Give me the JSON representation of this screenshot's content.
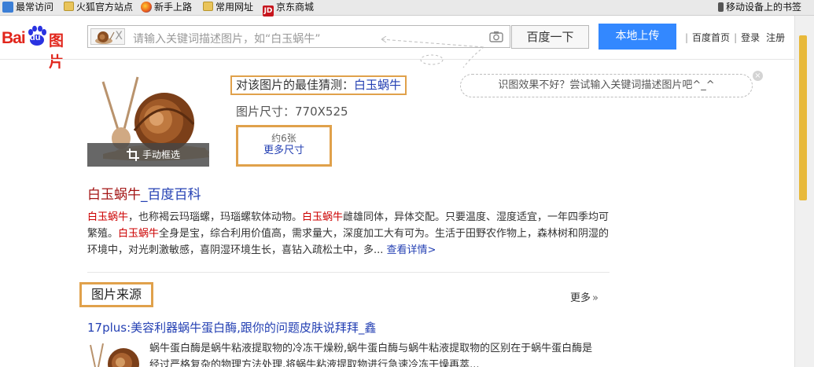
{
  "bookmarks": {
    "items": [
      {
        "label": "最常访问",
        "icon": "star-icon"
      },
      {
        "label": "火狐官方站点",
        "icon": "folder-icon"
      },
      {
        "label": "新手上路",
        "icon": "firefox-icon"
      },
      {
        "label": "常用网址",
        "icon": "folder-icon"
      },
      {
        "label": "京东商城",
        "icon": "jd-icon",
        "icon_text": "JD"
      }
    ],
    "mobile": "移动设备上的书签"
  },
  "header": {
    "logo_bai": "Bai",
    "logo_du": "du",
    "logo_tupian": "图片",
    "search_placeholder": "请输入关键词描述图片，如“白玉蜗牛”",
    "thumb_close": "X",
    "search_button": "百度一下",
    "upload_button": "本地上传",
    "links": [
      "百度首页",
      "登录",
      "注册"
    ]
  },
  "hint": {
    "text": "识图效果不好？尝试输入关键词描述图片吧^_^",
    "close": "×"
  },
  "result": {
    "crop_label": "手动框选",
    "guess_prefix": "对该图片的最佳猜测：",
    "guess_keyword": "白玉蜗牛",
    "size_text": "图片尺寸：770X525",
    "more_count": "约6张",
    "more_link": "更多尺寸"
  },
  "baike": {
    "title_kw": "白玉蜗牛",
    "title_rest": "_百度百科",
    "p1_kw": "白玉蜗牛",
    "p1_a": "，也称褐云玛瑙螺，玛瑙螺软体动物。",
    "p1_kw2": "白玉蜗牛",
    "p1_b": "雌雄同体，异体交配。只要温度、湿度适宜，一年四季均可繁殖。",
    "p1_kw3": "白玉蜗牛",
    "p1_c": "全身是宝，综合利用价值高，需求量大，深度加工大有可为。生活于田野农作物上，森林树和阴湿的环境中，对光刺激敏感，喜阴湿环境生长，喜钻入疏松土中，多...",
    "more_link": "查看详情>"
  },
  "sources": {
    "heading": "图片来源",
    "more": "更多",
    "more_icon": "double-chevron-right-icon",
    "item_title": "17plus:美容利器蜗牛蛋白酶,跟你的问题皮肤说拜拜_鑫",
    "item_desc": "蜗牛蛋白酶是蜗牛粘液提取物的冷冻干燥粉,蜗牛蛋白酶与蜗牛粘液提取物的区别在于蜗牛蛋白酶是经过严格复杂的物理方法处理,将蜗牛粘液提取物进行急速冷冻干燥再萃..."
  },
  "colors": {
    "brand_red": "#e1251b",
    "link_blue": "#2440b3",
    "upload_blue": "#3388ff",
    "highlight_orange": "#e0a14b",
    "keyword_red": "#cc0000",
    "scroll_thumb": "#e8b93a"
  }
}
